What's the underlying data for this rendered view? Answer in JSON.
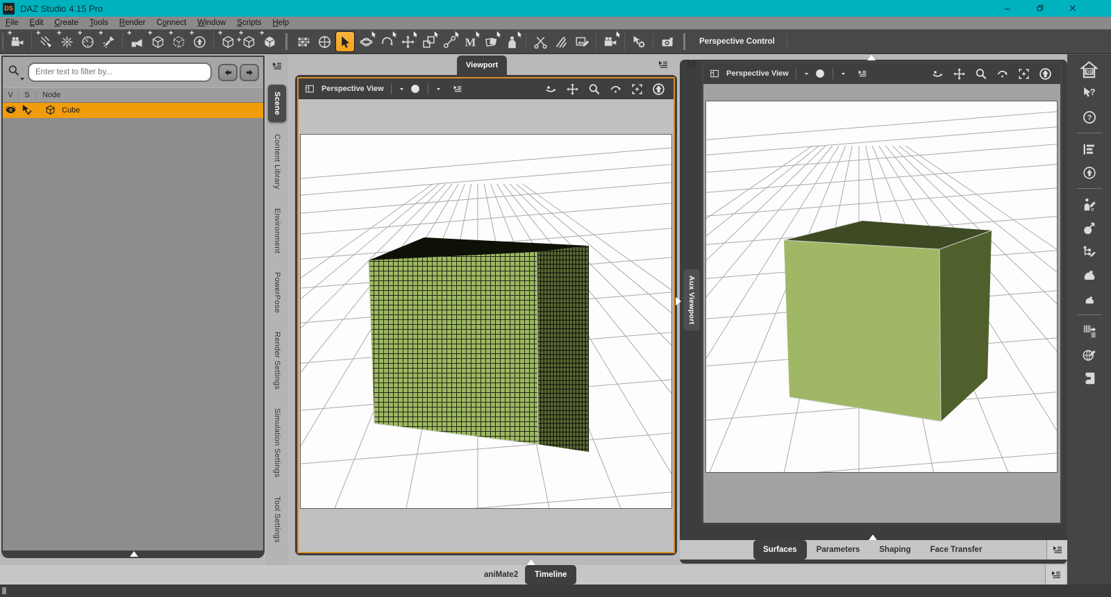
{
  "titlebar": {
    "logo": "DS",
    "title": "DAZ Studio 4.15 Pro"
  },
  "menubar": {
    "items": [
      {
        "pre": "",
        "key": "F",
        "post": "ile"
      },
      {
        "pre": "",
        "key": "E",
        "post": "dit"
      },
      {
        "pre": "",
        "key": "C",
        "post": "reate"
      },
      {
        "pre": "",
        "key": "T",
        "post": "ools"
      },
      {
        "pre": "",
        "key": "R",
        "post": "ender"
      },
      {
        "pre": "C",
        "key": "o",
        "post": "nnect"
      },
      {
        "pre": "",
        "key": "W",
        "post": "indow"
      },
      {
        "pre": "",
        "key": "S",
        "post": "cripts"
      },
      {
        "pre": "",
        "key": "H",
        "post": "elp"
      }
    ]
  },
  "toolbar": {
    "label": "Perspective Control",
    "items": [
      {
        "name": "new-camera",
        "sym": "camera",
        "plus": true
      },
      {
        "sep": "thin"
      },
      {
        "name": "new-distant-light",
        "sym": "distant",
        "plus": true
      },
      {
        "name": "new-point-light",
        "sym": "pointlight",
        "plus": true
      },
      {
        "name": "new-photometric-light",
        "sym": "gauge",
        "plus": true
      },
      {
        "name": "new-spotlight",
        "sym": "spotlight",
        "plus": true
      },
      {
        "sep": "thin"
      },
      {
        "name": "new-camera-view",
        "sym": "projector",
        "plus": true
      },
      {
        "name": "new-group",
        "sym": "cube-wire",
        "plus": true
      },
      {
        "name": "new-selection-set",
        "sym": "cube-dashed",
        "plus": true
      },
      {
        "name": "new-null",
        "sym": "null",
        "plus": true
      },
      {
        "sep": "thin"
      },
      {
        "name": "new-node",
        "sym": "cube-wire",
        "plus": true
      },
      {
        "name": "new-node-instance",
        "sym": "cube-wire",
        "plus": true,
        "plus2": true
      },
      {
        "name": "new-primitive",
        "sym": "cube-solid",
        "plus": true
      },
      {
        "sep": "thick"
      },
      {
        "name": "viewport-layout",
        "sym": "tiles"
      },
      {
        "name": "aim-at",
        "sym": "aim"
      },
      {
        "name": "node-selection-tool",
        "sym": "cursor",
        "active": true
      },
      {
        "name": "rotate-tool",
        "sym": "gyro",
        "cursor": true
      },
      {
        "name": "active-pose-tool",
        "sym": "arc",
        "cursor": true
      },
      {
        "name": "translate-tool",
        "sym": "move4",
        "cursor": true
      },
      {
        "name": "scale-tool",
        "sym": "scale",
        "cursor": true
      },
      {
        "name": "joint-editor-tool",
        "sym": "bone",
        "cursor": true
      },
      {
        "name": "mesh-grabber-tool",
        "sym": "letter-m",
        "cursor": true
      },
      {
        "name": "surface-selection-tool",
        "sym": "layers",
        "cursor": true
      },
      {
        "name": "figure-selection-tool",
        "sym": "figure",
        "cursor": true
      },
      {
        "sep": "thin"
      },
      {
        "name": "geometry-editor-tool",
        "sym": "scissors"
      },
      {
        "name": "weight-brush-tool",
        "sym": "brushes"
      },
      {
        "name": "region-editor-tool",
        "sym": "image-edit"
      },
      {
        "sep": "thin"
      },
      {
        "name": "camera-selection",
        "sym": "camera",
        "cursor": true
      },
      {
        "sep": "thin"
      },
      {
        "name": "tool-settings",
        "sym": "cursor-gear"
      },
      {
        "sep": "thin"
      },
      {
        "name": "render",
        "sym": "camera-solid"
      }
    ]
  },
  "left_tabs": {
    "items": [
      {
        "label": "Scene",
        "active": true
      },
      {
        "label": "Content Library"
      },
      {
        "label": "Environment"
      },
      {
        "label": "PowerPose"
      },
      {
        "label": "Render Settings"
      },
      {
        "label": "Simulation Settings"
      },
      {
        "label": "Tool Settings"
      }
    ]
  },
  "scene_panel": {
    "search_placeholder": "Enter text to filter by...",
    "columns": {
      "visibility": "V",
      "selection": "S",
      "node": "Node"
    },
    "rows": [
      {
        "label": "Cube",
        "visible": true,
        "selected": true
      }
    ]
  },
  "viewport": {
    "tab": "Viewport",
    "view_label": "Perspective View"
  },
  "aux_viewport": {
    "tab": "Aux Viewport",
    "view_label": "Perspective View"
  },
  "viewport_header": {
    "left_icons": [
      "viewport-pane",
      "caret-down",
      "drawstyle-sphere",
      "caret-down",
      "pane-options"
    ],
    "right_icons": [
      "orbit",
      "pan",
      "dolly-zoom",
      "rotate",
      "frame",
      "reset-camera"
    ]
  },
  "right_tabs": {
    "items": [
      {
        "label": "Surfaces",
        "active": true
      },
      {
        "label": "Parameters"
      },
      {
        "label": "Shaping"
      },
      {
        "label": "Face Transfer"
      }
    ]
  },
  "bottom_tabs": {
    "items": [
      {
        "label": "aniMate2"
      },
      {
        "label": "Timeline",
        "active": true
      }
    ]
  },
  "right_strip": {
    "items": [
      {
        "name": "daz-home",
        "sym": "ds-home",
        "big": true
      },
      {
        "name": "whats-this-help",
        "sym": "cursor-question"
      },
      {
        "name": "help",
        "sym": "circle-question"
      },
      {
        "sep": true
      },
      {
        "name": "outline-panel",
        "sym": "list"
      },
      {
        "name": "null-node",
        "sym": "null"
      },
      {
        "sep": true
      },
      {
        "name": "figure-setup",
        "sym": "figure-pencil"
      },
      {
        "name": "pose-tool",
        "sym": "sphere-arrow"
      },
      {
        "name": "hierarchy-editor",
        "sym": "nodes-pencil"
      },
      {
        "name": "muscularity-morph",
        "sym": "arm"
      },
      {
        "name": "flex-morph",
        "sym": "arm-small"
      },
      {
        "sep": true
      },
      {
        "name": "transfer-utility",
        "sym": "grid-arrows"
      },
      {
        "name": "geometry-edit",
        "sym": "globe-pencil"
      },
      {
        "name": "exit",
        "sym": "door-arrow"
      }
    ]
  },
  "colors": {
    "titlebar": "#00b2bd",
    "selection": "#f09c0b",
    "tool_active": "#f5a11c",
    "viewport_border": "#d98e2b",
    "cube_front": "#9db860",
    "cube_side": "#5f6e35",
    "cube_top": "#0e1106",
    "aux_cube_front": "#a0b765",
    "aux_cube_side": "#50602c",
    "aux_cube_top": "#3d4a23"
  }
}
